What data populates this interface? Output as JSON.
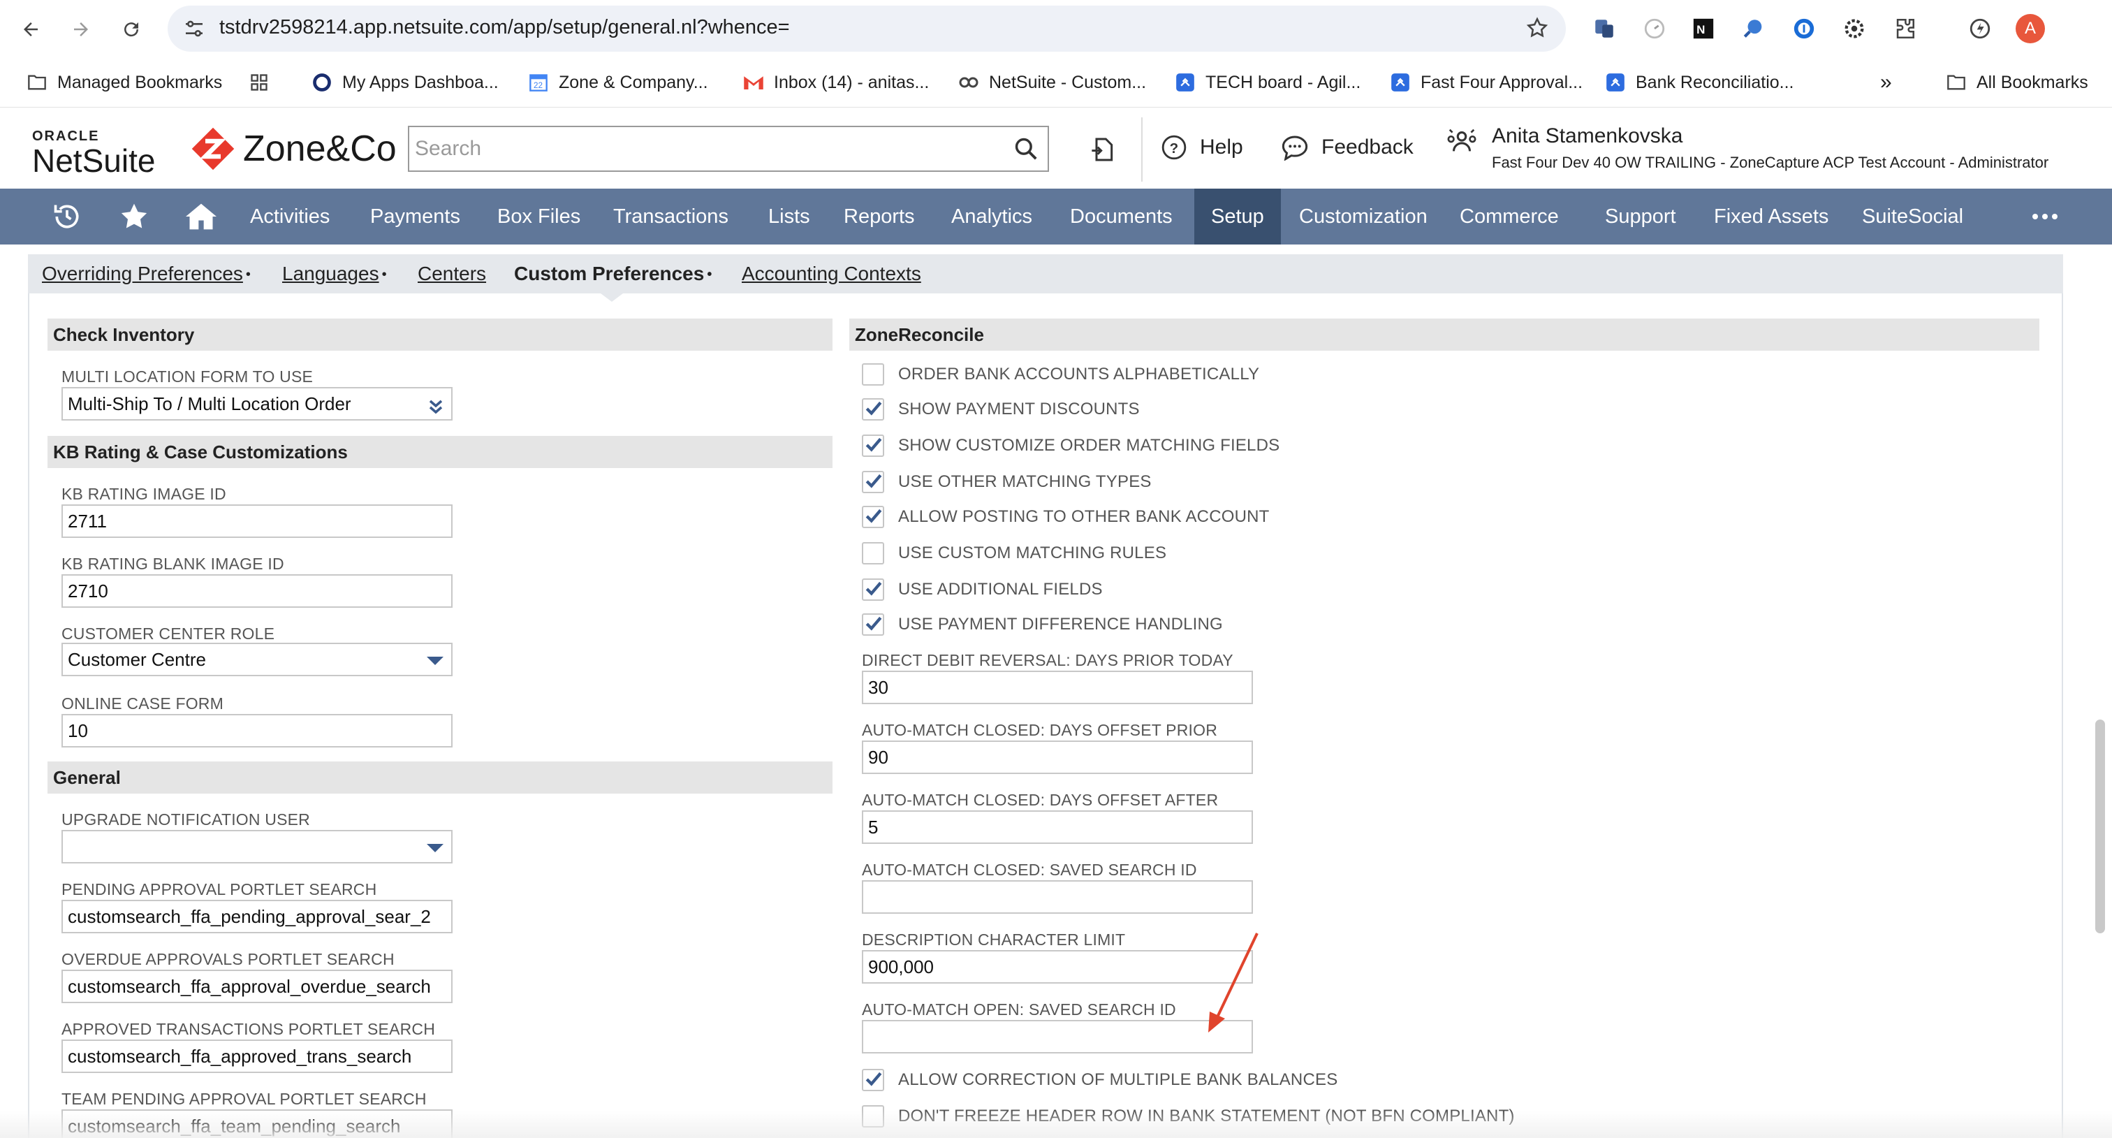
{
  "browser": {
    "url": "tstdrv2598214.app.netsuite.com/app/setup/general.nl?whence=",
    "profile_initial": "A",
    "bookmarks": [
      {
        "label": "Managed Bookmarks",
        "icon": "folder-managed-icon"
      },
      {
        "label": "",
        "icon": "apps-grid-icon"
      },
      {
        "label": "My Apps Dashboa...",
        "icon": "okta-icon"
      },
      {
        "label": "Zone & Company...",
        "icon": "calendar-icon"
      },
      {
        "label": "Inbox (14) - anitas...",
        "icon": "gmail-icon"
      },
      {
        "label": "NetSuite - Custom...",
        "icon": "salesforce-icon"
      },
      {
        "label": "TECH board - Agil...",
        "icon": "jira-icon"
      },
      {
        "label": "Fast Four Approval...",
        "icon": "jira-icon"
      },
      {
        "label": "Bank Reconciliatio...",
        "icon": "jira-icon"
      }
    ],
    "more_bookmarks": "»",
    "all_bookmarks": "All Bookmarks"
  },
  "header": {
    "oracle_small": "ORACLE",
    "oracle_big": "NetSuite",
    "company_logo": "Zone&Co",
    "search_placeholder": "Search",
    "help": "Help",
    "feedback": "Feedback",
    "user_name": "Anita Stamenkovska",
    "user_account": "Fast Four Dev 40 OW TRAILING - ZoneCapture ACP Test Account - Administrator"
  },
  "nav": {
    "items": [
      "Activities",
      "Payments",
      "Box Files",
      "Transactions",
      "Lists",
      "Reports",
      "Analytics",
      "Documents",
      "Setup",
      "Customization",
      "Commerce",
      "Support",
      "Fixed Assets",
      "SuiteSocial"
    ],
    "active": "Setup"
  },
  "subtabs": [
    {
      "label": "Overriding Preferences",
      "dot": "•",
      "active": false
    },
    {
      "label": "Languages",
      "dot": "•",
      "active": false
    },
    {
      "label": "Centers",
      "dot": "",
      "active": false
    },
    {
      "label": "Custom Preferences",
      "dot": "•",
      "active": true
    },
    {
      "label": "Accounting Contexts",
      "dot": "",
      "active": false
    }
  ],
  "left": {
    "check_inventory": {
      "title": "Check Inventory",
      "multi_location_label": "MULTI LOCATION FORM TO USE",
      "multi_location_value": "Multi-Ship To / Multi Location Order"
    },
    "kb": {
      "title": "KB Rating & Case Customizations",
      "image_id_label": "KB RATING IMAGE ID",
      "image_id_value": "2711",
      "blank_id_label": "KB RATING BLANK IMAGE ID",
      "blank_id_value": "2710",
      "role_label": "CUSTOMER CENTER ROLE",
      "role_value": "Customer Centre",
      "case_form_label": "ONLINE CASE FORM",
      "case_form_value": "10"
    },
    "general": {
      "title": "General",
      "upgrade_label": "UPGRADE NOTIFICATION USER",
      "upgrade_value": "",
      "pending_label": "PENDING APPROVAL PORTLET SEARCH",
      "pending_value": "customsearch_ffa_pending_approval_sear_2",
      "overdue_label": "OVERDUE APPROVALS PORTLET SEARCH",
      "overdue_value": "customsearch_ffa_approval_overdue_search",
      "approved_label": "APPROVED TRANSACTIONS PORTLET SEARCH",
      "approved_value": "customsearch_ffa_approved_trans_search",
      "team_label": "TEAM PENDING APPROVAL PORTLET SEARCH",
      "team_value": "customsearch_ffa_team_pending_search"
    }
  },
  "right": {
    "title": "ZoneReconcile",
    "checkboxes": [
      {
        "label": "ORDER BANK ACCOUNTS ALPHABETICALLY",
        "checked": false
      },
      {
        "label": "SHOW PAYMENT DISCOUNTS",
        "checked": true
      },
      {
        "label": "SHOW CUSTOMIZE ORDER MATCHING FIELDS",
        "checked": true
      },
      {
        "label": "USE OTHER MATCHING TYPES",
        "checked": true
      },
      {
        "label": "ALLOW POSTING TO OTHER BANK ACCOUNT",
        "checked": true
      },
      {
        "label": "USE CUSTOM MATCHING RULES",
        "checked": false
      },
      {
        "label": "USE ADDITIONAL FIELDS",
        "checked": true
      },
      {
        "label": "USE PAYMENT DIFFERENCE HANDLING",
        "checked": true
      }
    ],
    "fields": [
      {
        "label": "DIRECT DEBIT REVERSAL: DAYS PRIOR TODAY",
        "value": "30"
      },
      {
        "label": "AUTO-MATCH CLOSED: DAYS OFFSET PRIOR",
        "value": "90"
      },
      {
        "label": "AUTO-MATCH CLOSED: DAYS OFFSET AFTER",
        "value": "5"
      },
      {
        "label": "AUTO-MATCH CLOSED: SAVED SEARCH ID",
        "value": ""
      },
      {
        "label": "DESCRIPTION CHARACTER LIMIT",
        "value": "900,000"
      },
      {
        "label": "AUTO-MATCH OPEN: SAVED SEARCH ID",
        "value": ""
      }
    ],
    "bottom_checkboxes": [
      {
        "label": "ALLOW CORRECTION OF MULTIPLE BANK BALANCES",
        "checked": true
      },
      {
        "label": "DON'T FREEZE HEADER ROW IN BANK STATEMENT (NOT BFN COMPLIANT)",
        "checked": false
      }
    ]
  },
  "colors": {
    "nav_bg": "#607799",
    "nav_active": "#39506f",
    "checkbox_tick": "#3a5a8c",
    "annotation_arrow": "#e0442c",
    "zone_logo_red": "#e8392c"
  }
}
